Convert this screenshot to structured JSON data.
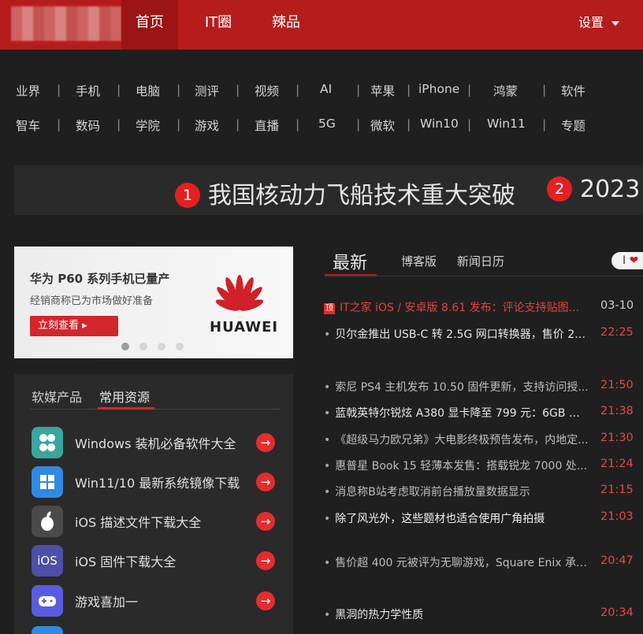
{
  "nav": {
    "items": [
      "首页",
      "IT圈",
      "辣品"
    ],
    "settings": "设置"
  },
  "categories": {
    "row1": [
      "业界",
      "手机",
      "电脑",
      "测评",
      "视频",
      "AI",
      "苹果",
      "iPhone",
      "鸿蒙",
      "软件"
    ],
    "row2": [
      "智车",
      "数码",
      "学院",
      "游戏",
      "直播",
      "5G",
      "微软",
      "Win10",
      "Win11",
      "专题"
    ]
  },
  "headlines": [
    {
      "num": "1",
      "text": "我国核动力飞船技术重大突破"
    },
    {
      "num": "2",
      "text": "2023"
    }
  ],
  "banner": {
    "title": "华为 P60 系列手机已量产",
    "subtitle": "经销商称已为市场做好准备",
    "button": "立刻查看 ▸",
    "brand": "HUAWEI"
  },
  "resources": {
    "tabs": [
      "软媒产品",
      "常用资源"
    ],
    "items": [
      {
        "label": "Windows 装机必备软件大全",
        "icon": "grid-apps-icon",
        "color": "#3aa6a0"
      },
      {
        "label": "Win11/10 最新系统镜像下载",
        "icon": "windows-logo-icon",
        "color": "#2f8ae5"
      },
      {
        "label": "iOS 描述文件下载大全",
        "icon": "apple-logo-icon",
        "color": "#4a4a4a"
      },
      {
        "label": "iOS 固件下载大全",
        "icon": "ios-text-icon",
        "color": "#4d4fa8"
      },
      {
        "label": "游戏喜加一",
        "icon": "gamepad-icon",
        "color": "#5a5ce0"
      }
    ],
    "go_arrow": "→",
    "ios_badge": "iOS"
  },
  "news": {
    "tabs": [
      "最新",
      "博客版",
      "新闻日历"
    ],
    "pill_text": "I",
    "pill_heart": "❤",
    "top_badge": "顶",
    "items": [
      {
        "title": "IT之家 iOS / 安卓版 8.61 发布：评论支持贴图...",
        "time": "03-10",
        "pinned": true
      },
      {
        "title": "贝尔金推出 USB-C 转 2.5G 网口转换器，售价 28...",
        "time": "22:25",
        "pinned": false
      },
      {
        "title": "索尼 PS4 主机发布 10.50 固件更新，支持访问授...",
        "time": "21:50",
        "pinned": false
      },
      {
        "title": "蓝戟英特尔锐炫 A380 显卡降至 799 元：6GB 显...",
        "time": "21:38",
        "pinned": false
      },
      {
        "title": "《超级马力欧兄弟》大电影终极预告发布，内地定...",
        "time": "21:30",
        "pinned": false
      },
      {
        "title": "惠普星 Book 15 轻薄本发售：搭载锐龙 7000 处...",
        "time": "21:24",
        "pinned": false
      },
      {
        "title": "消息称B站考虑取消前台播放量数据显示",
        "time": "21:15",
        "pinned": false
      },
      {
        "title": "除了风光外，这些题材也适合使用广角拍摄",
        "time": "21:03",
        "pinned": false
      },
      {
        "title": "售价超 400 元被评为无聊游戏，Square Enix 承认...",
        "time": "20:47",
        "pinned": false
      },
      {
        "title": "黑洞的热力学性质",
        "time": "20:34",
        "pinned": false
      }
    ]
  },
  "colors": {
    "brand_red": "#b51c1c",
    "accent_red": "#e42121",
    "bg": "#1f1f1f"
  }
}
